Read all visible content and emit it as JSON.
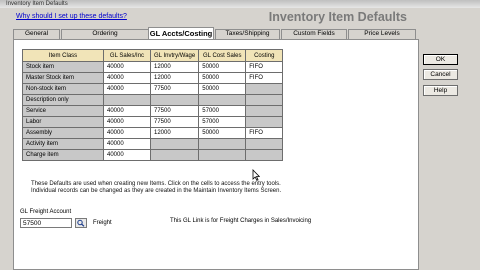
{
  "window": {
    "title": "Inventory Item Defaults"
  },
  "help_link": "Why should I set up these defaults?",
  "dialog_title": "Inventory Item Defaults",
  "tabs": [
    {
      "label": "General",
      "active": false
    },
    {
      "label": "Ordering",
      "active": false
    },
    {
      "label": "GL Accts/Costing",
      "active": true
    },
    {
      "label": "Taxes/Shipping",
      "active": false
    },
    {
      "label": "Custom Fields",
      "active": false
    },
    {
      "label": "Price Levels",
      "active": false
    }
  ],
  "grid": {
    "headers": [
      "Item Class",
      "GL Sales/Inc",
      "GL Invtry/Wage",
      "GL Cost Sales",
      "Costing"
    ],
    "rows": [
      [
        "Stock item",
        "40000",
        "12000",
        "50000",
        "FIFO"
      ],
      [
        "Master Stock item",
        "40000",
        "12000",
        "50000",
        "FIFO"
      ],
      [
        "Non-stock item",
        "40000",
        "77500",
        "50000",
        ""
      ],
      [
        "Description only",
        "",
        "",
        "",
        ""
      ],
      [
        "Service",
        "40000",
        "77500",
        "57000",
        ""
      ],
      [
        "Labor",
        "40000",
        "77500",
        "57000",
        ""
      ],
      [
        "Assembly",
        "40000",
        "12000",
        "50000",
        "FIFO"
      ],
      [
        "Activity item",
        "40000",
        "",
        "",
        ""
      ],
      [
        "Charge item",
        "40000",
        "",
        "",
        ""
      ]
    ]
  },
  "note": "These Defaults are used when creating new Items. Click on the cells to access the entry tools. Individual records can be changed as they are created in the Maintain Inventory Items Screen.",
  "freight": {
    "label": "GL Freight Account",
    "value": "57500",
    "name": "Freight",
    "note": "This GL Link is for Freight Charges in Sales/Invoicing"
  },
  "buttons": {
    "ok": "OK",
    "cancel": "Cancel",
    "help": "Help"
  },
  "colors": {
    "header_fill": "#f1e4b8",
    "label_fill": "#c8c8c8",
    "title_gray": "#7a7a7a",
    "link_blue": "#0000cc"
  }
}
